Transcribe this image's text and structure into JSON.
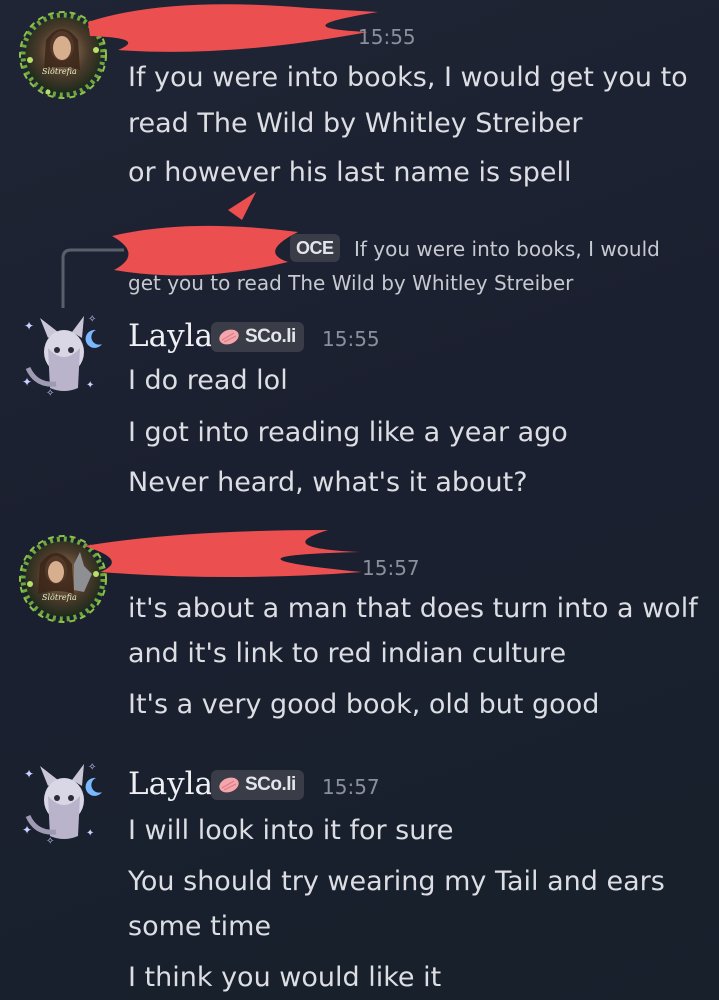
{
  "messages": [
    {
      "author": "",
      "timestamp": "15:55",
      "lines": [
        "If you were into books, I would get you to",
        "read The Wild by Whitley Streiber",
        "or however his last name is spell"
      ]
    },
    {
      "author": "Layla",
      "tag": "SCo.li",
      "timestamp": "15:55",
      "reply": {
        "tag": "OCE",
        "line1": "If you were into books, I would",
        "line2": "get you to read The Wild by Whitley Streiber"
      },
      "lines": [
        "I do read lol",
        "I got into reading like a year ago",
        "Never heard, what's it about?"
      ]
    },
    {
      "author": "",
      "timestamp": "15:57",
      "lines": [
        "it's about a man that does turn into a wolf",
        "and it's link to red indian culture",
        "It's a very good book, old but good"
      ]
    },
    {
      "author": "Layla",
      "tag": "SCo.li",
      "timestamp": "15:57",
      "lines": [
        "I will look into it for sure",
        "You should try wearing my Tail and ears",
        "some time",
        "I think you would like it"
      ]
    }
  ],
  "colors": {
    "redaction": "#ec4f4f",
    "timestamp": "#8b8f9b",
    "text": "#dcdee3",
    "badge_bg": "#3a3d48"
  },
  "icons": {
    "tag_icon": "pink-shell-icon",
    "avatar_1": "wreath-avatar",
    "avatar_2": "starry-fox-avatar"
  }
}
